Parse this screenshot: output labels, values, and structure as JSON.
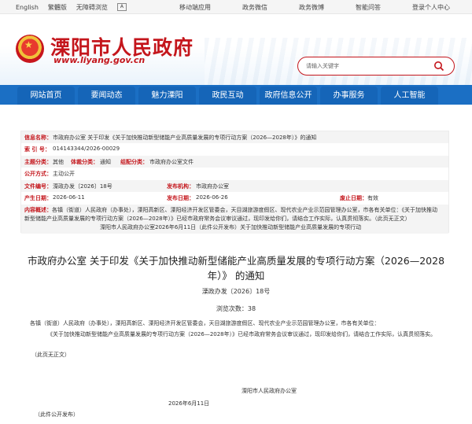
{
  "topbar": {
    "lang_en": "English",
    "lang_tc": "繁體版",
    "accessible": "无障碍浏览",
    "right_items": [
      "移动端应用",
      "政务微信",
      "政务微博",
      "智能问答",
      "登录个人中心"
    ]
  },
  "header": {
    "site_name": "溧阳市人民政府",
    "site_url": "www.liyang.gov.cn",
    "search_placeholder": "请输入关键字"
  },
  "nav": [
    "网站首页",
    "要闻动态",
    "魅力溧阳",
    "政民互动",
    "政府信息公开",
    "办事服务",
    "人工智能"
  ],
  "meta": {
    "info_name_label": "信息名称：",
    "info_name": "市政府办公室 关于印发《关于加快推动新型储能产业高质量发展的专项行动方案（2026—2028年）》的通知",
    "index_label": "索 引 号：",
    "index": "014143344/2026-00029",
    "topic_label": "主题分类：",
    "topic": "其他",
    "genre_label": "体裁分类：",
    "genre": "通知",
    "org_cat_label": "组配分类：",
    "org_cat": "市政府办公室文件",
    "open_mode_label": "公开方式：",
    "open_mode": "主动公开",
    "doc_no_label": "文件编号：",
    "doc_no": "溧政办发〔2026〕18号",
    "issuer_label": "发布机构：",
    "issuer": "市政府办公室",
    "created_label": "产生日期：",
    "created": "2026-06-11",
    "published_label": "发布日期：",
    "published": "2026-06-26",
    "validity_label": "废止日期：",
    "validity": "有效",
    "overview_label": "内容概述：",
    "overview": "各镇（街道）人民政府（办事处），溧阳高新区、溧阳经济开发区管委会，天目湖旅游度假区、现代农业产业示范园管理办公室，市各有关单位：《关于加快推动新型储能产业高质量发展的专项行动方案（2026—2028年）》已经市政府常务会议审议通过，现印发给你们，请结合工作实际，认真贯彻落实。（此页无正文）",
    "overview_tail": "溧阳市人民政府办公室2026年6月11日（此件公开发布）关于加快推动新型储能产业高质量发展的专项行动"
  },
  "article": {
    "title": "市政府办公室 关于印发《关于加快推动新型储能产业高质量发展的专项行动方案（2026—2028年）》 的通知",
    "doc_no": "溧政办发〔2026〕18号",
    "views_label": "浏览次数：",
    "views": "38",
    "para1": "各镇（街道）人民政府（办事处），溧阳高新区、溧阳经济开发区管委会，天目湖旅游度假区、现代农业产业示范园管理办公室，市各有关单位：",
    "para2": "《关于加快推动新型储能产业高质量发展的专项行动方案（2026—2028年）》已经市政府常务会议审议通过，现印发给你们，请结合工作实际，认真贯彻落实。",
    "no_text": "（此页无正文）",
    "signer": "溧阳市人民政府办公室",
    "date": "2026年6月11日",
    "release": "（此件公开发布）"
  }
}
